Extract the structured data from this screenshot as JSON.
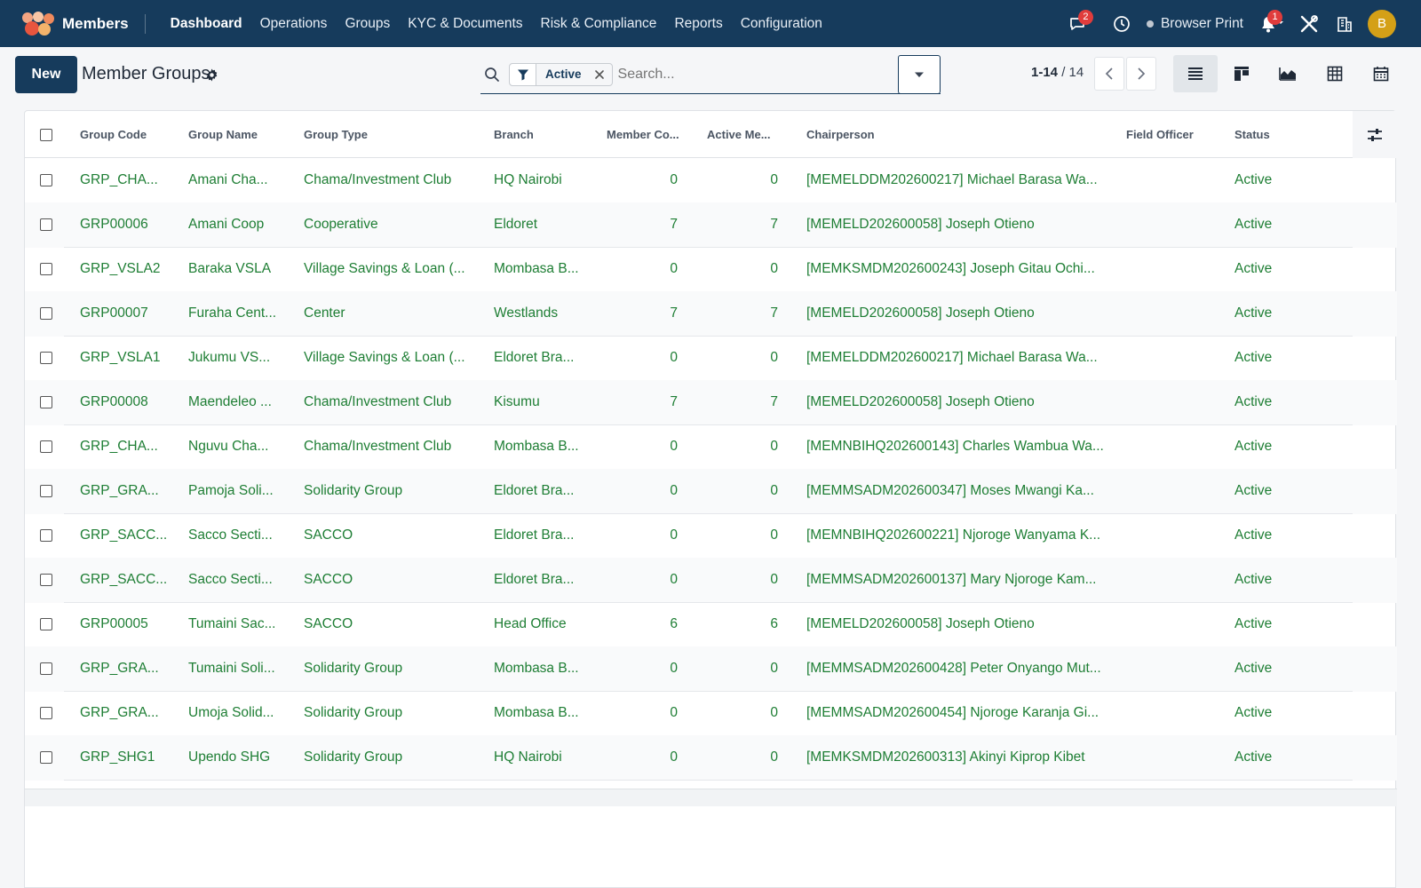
{
  "app": {
    "name": "Members"
  },
  "nav": {
    "menu": [
      "Dashboard",
      "Operations",
      "Groups",
      "KYC & Documents",
      "Risk & Compliance",
      "Reports",
      "Configuration"
    ],
    "messages_badge": "2",
    "notifications_badge": "1",
    "browser_print": "Browser Print",
    "avatar_initial": "B"
  },
  "control": {
    "new_label": "New",
    "title": "Member Groups",
    "facet_label": "Active",
    "search_placeholder": "Search...",
    "pager_range": "1-14",
    "pager_total": "/ 14"
  },
  "table": {
    "headers": {
      "group_code": "Group Code",
      "group_name": "Group Name",
      "group_type": "Group Type",
      "branch": "Branch",
      "member_count": "Member Co...",
      "active_members": "Active Me...",
      "chairperson": "Chairperson",
      "field_officer": "Field Officer",
      "status": "Status"
    },
    "rows": [
      {
        "code": "GRP_CHA...",
        "name": "Amani Cha...",
        "type": "Chama/Investment Club",
        "branch": "HQ Nairobi",
        "members": "0",
        "active": "0",
        "chair": "[MEMELDDM202600217] Michael Barasa Wa...",
        "officer": "",
        "status": "Active"
      },
      {
        "code": "GRP00006",
        "name": "Amani Coop",
        "type": "Cooperative",
        "branch": "Eldoret",
        "members": "7",
        "active": "7",
        "chair": "[MEMELD202600058] Joseph Otieno",
        "officer": "",
        "status": "Active"
      },
      {
        "code": "GRP_VSLA2",
        "name": "Baraka VSLA",
        "type": "Village Savings & Loan (...",
        "branch": "Mombasa B...",
        "members": "0",
        "active": "0",
        "chair": "[MEMKSMDM202600243] Joseph Gitau Ochi...",
        "officer": "",
        "status": "Active"
      },
      {
        "code": "GRP00007",
        "name": "Furaha Cent...",
        "type": "Center",
        "branch": "Westlands",
        "members": "7",
        "active": "7",
        "chair": "[MEMELD202600058] Joseph Otieno",
        "officer": "",
        "status": "Active"
      },
      {
        "code": "GRP_VSLA1",
        "name": "Jukumu VS...",
        "type": "Village Savings & Loan (...",
        "branch": "Eldoret Bra...",
        "members": "0",
        "active": "0",
        "chair": "[MEMELDDM202600217] Michael Barasa Wa...",
        "officer": "",
        "status": "Active"
      },
      {
        "code": "GRP00008",
        "name": "Maendeleo ...",
        "type": "Chama/Investment Club",
        "branch": "Kisumu",
        "members": "7",
        "active": "7",
        "chair": "[MEMELD202600058] Joseph Otieno",
        "officer": "",
        "status": "Active"
      },
      {
        "code": "GRP_CHA...",
        "name": "Nguvu Cha...",
        "type": "Chama/Investment Club",
        "branch": "Mombasa B...",
        "members": "0",
        "active": "0",
        "chair": "[MEMNBIHQ202600143] Charles Wambua Wa...",
        "officer": "",
        "status": "Active"
      },
      {
        "code": "GRP_GRA...",
        "name": "Pamoja Soli...",
        "type": "Solidarity Group",
        "branch": "Eldoret Bra...",
        "members": "0",
        "active": "0",
        "chair": "[MEMMSADM202600347] Moses Mwangi Ka...",
        "officer": "",
        "status": "Active"
      },
      {
        "code": "GRP_SACC...",
        "name": "Sacco Secti...",
        "type": "SACCO",
        "branch": "Eldoret Bra...",
        "members": "0",
        "active": "0",
        "chair": "[MEMNBIHQ202600221] Njoroge Wanyama K...",
        "officer": "",
        "status": "Active"
      },
      {
        "code": "GRP_SACC...",
        "name": "Sacco Secti...",
        "type": "SACCO",
        "branch": "Eldoret Bra...",
        "members": "0",
        "active": "0",
        "chair": "[MEMMSADM202600137] Mary Njoroge Kam...",
        "officer": "",
        "status": "Active"
      },
      {
        "code": "GRP00005",
        "name": "Tumaini Sac...",
        "type": "SACCO",
        "branch": "Head Office",
        "members": "6",
        "active": "6",
        "chair": "[MEMELD202600058] Joseph Otieno",
        "officer": "",
        "status": "Active"
      },
      {
        "code": "GRP_GRA...",
        "name": "Tumaini Soli...",
        "type": "Solidarity Group",
        "branch": "Mombasa B...",
        "members": "0",
        "active": "0",
        "chair": "[MEMMSADM202600428] Peter Onyango Mut...",
        "officer": "",
        "status": "Active"
      },
      {
        "code": "GRP_GRA...",
        "name": "Umoja Solid...",
        "type": "Solidarity Group",
        "branch": "Mombasa B...",
        "members": "0",
        "active": "0",
        "chair": "[MEMMSADM202600454] Njoroge Karanja Gi...",
        "officer": "",
        "status": "Active"
      },
      {
        "code": "GRP_SHG1",
        "name": "Upendo SHG",
        "type": "Solidarity Group",
        "branch": "HQ Nairobi",
        "members": "0",
        "active": "0",
        "chair": "[MEMKSMDM202600313] Akinyi Kiprop Kibet",
        "officer": "",
        "status": "Active"
      }
    ]
  },
  "colors": {
    "navbar": "#163b5c",
    "link_green": "#1e7e34",
    "badge_red": "#e03c3c",
    "avatar": "#d4a017"
  }
}
